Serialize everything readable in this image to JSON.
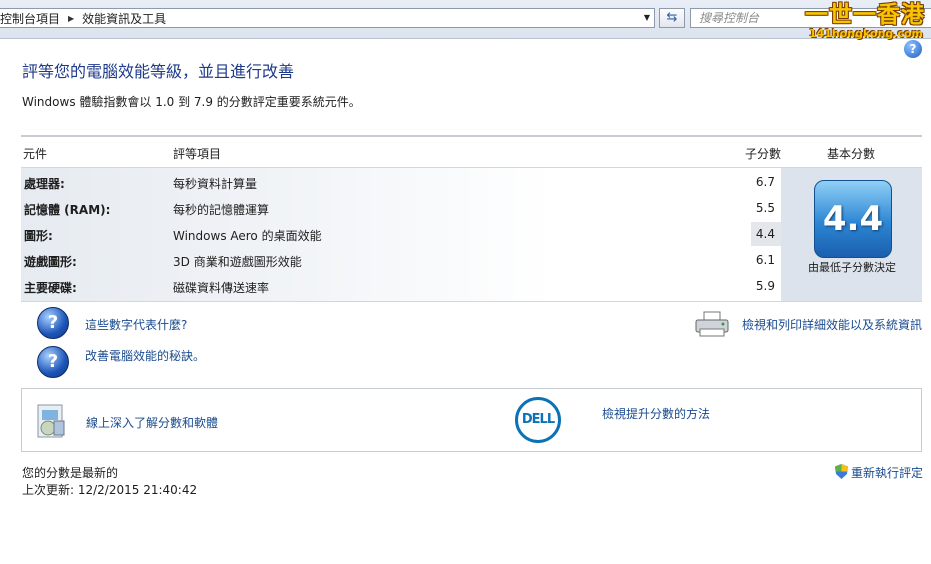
{
  "address_bar": {
    "breadcrumb": [
      "控制台項目",
      "效能資訊及工具"
    ],
    "search_placeholder": "搜尋控制台"
  },
  "watermark": {
    "title": "一世一香港",
    "site": "141hongkong.com"
  },
  "help_button": "?",
  "page": {
    "title": "評等您的電腦效能等級，並且進行改善",
    "description": "Windows 體驗指數會以 1.0 到 7.9 的分數評定重要系統元件。"
  },
  "table": {
    "headers": {
      "component": "元件",
      "rated_item": "評等項目",
      "subscore": "子分數",
      "base_score": "基本分數"
    },
    "rows": [
      {
        "component": "處理器:",
        "item": "每秒資料計算量",
        "subscore": "6.7"
      },
      {
        "component": "記憶體 (RAM):",
        "item": "每秒的記憶體運算",
        "subscore": "5.5"
      },
      {
        "component": "圖形:",
        "item": "Windows Aero 的桌面效能",
        "subscore": "4.4"
      },
      {
        "component": "遊戲圖形:",
        "item": "3D 商業和遊戲圖形效能",
        "subscore": "6.1"
      },
      {
        "component": "主要硬碟:",
        "item": "磁碟資料傳送速率",
        "subscore": "5.9"
      }
    ],
    "base_score": "4.4",
    "base_caption": "由最低子分數決定"
  },
  "links": {
    "what_numbers_mean": "這些數字代表什麼?",
    "improve_tips": "改善電腦效能的秘訣。",
    "print_details": "檢視和列印詳細效能以及系統資訊",
    "learn_online": "線上深入了解分數和軟體",
    "improve_score": "檢視提升分數的方法"
  },
  "dell_logo_text": "DELL",
  "status": {
    "current": "您的分數是最新的",
    "last_update": "上次更新: 12/2/2015 21:40:42",
    "rerun": "重新執行評定"
  }
}
